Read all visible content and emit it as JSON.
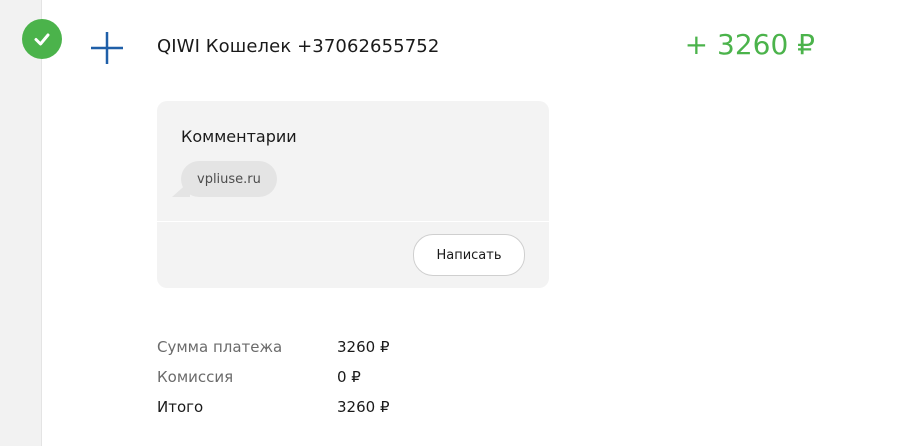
{
  "transaction": {
    "status_icon": "check-icon",
    "type_icon": "plus-icon",
    "title": "QIWI Кошелек +37062655752",
    "amount": "+ 3260 ₽",
    "amount_color": "#4bb34b"
  },
  "comments": {
    "heading": "Комментарии",
    "items": [
      "vpliuse.ru"
    ],
    "write_button_label": "Написать"
  },
  "details": {
    "rows": [
      {
        "label": "Сумма платежа",
        "value": "3260 ₽"
      },
      {
        "label": "Комиссия",
        "value": "0 ₽"
      },
      {
        "label": "Итого",
        "value": "3260 ₽"
      }
    ]
  }
}
